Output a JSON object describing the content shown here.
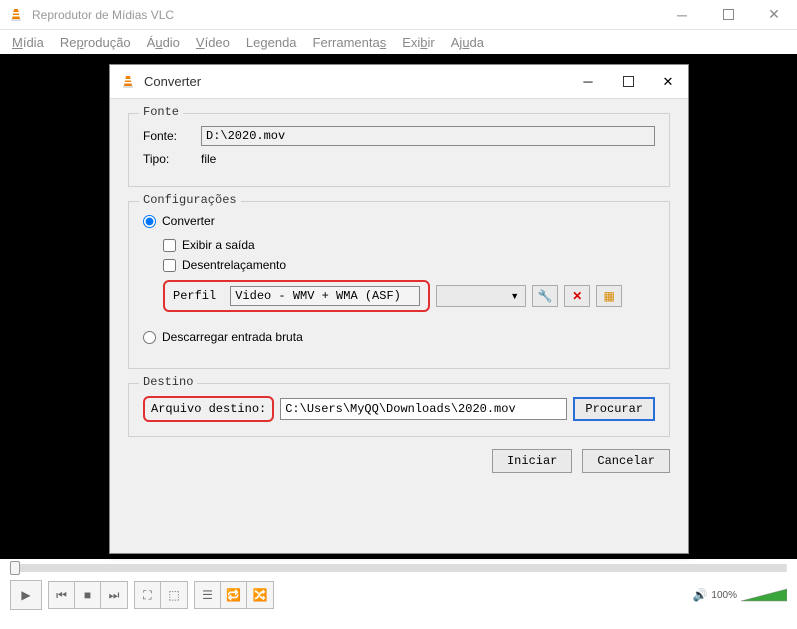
{
  "main": {
    "title": "Reprodutor de Mídias VLC",
    "menu": {
      "midia": "Mídia",
      "reproducao": "Reprodução",
      "audio": "Áudio",
      "video": "Vídeo",
      "legenda": "Legenda",
      "ferramentas": "Ferramentas",
      "exibir": "Exibir",
      "ajuda": "Ajuda"
    }
  },
  "dialog": {
    "title": "Converter",
    "fonte": {
      "legend": "Fonte",
      "fonte_label": "Fonte:",
      "fonte_value": "D:\\2020.mov",
      "tipo_label": "Tipo:",
      "tipo_value": "file"
    },
    "config": {
      "legend": "Configurações",
      "converter": "Converter",
      "exibir_saida": "Exibir a saída",
      "desentrelacamento": "Desentrelaçamento",
      "perfil_label": "Perfil",
      "perfil_value": "Video - WMV + WMA (ASF)",
      "descarregar": "Descarregar entrada bruta"
    },
    "destino": {
      "legend": "Destino",
      "arquivo_label": "Arquivo destino:",
      "arquivo_value": "C:\\Users\\MyQQ\\Downloads\\2020.mov",
      "procurar": "Procurar"
    },
    "buttons": {
      "iniciar": "Iniciar",
      "cancelar": "Cancelar"
    }
  },
  "controls": {
    "volume_pct": "100%"
  }
}
